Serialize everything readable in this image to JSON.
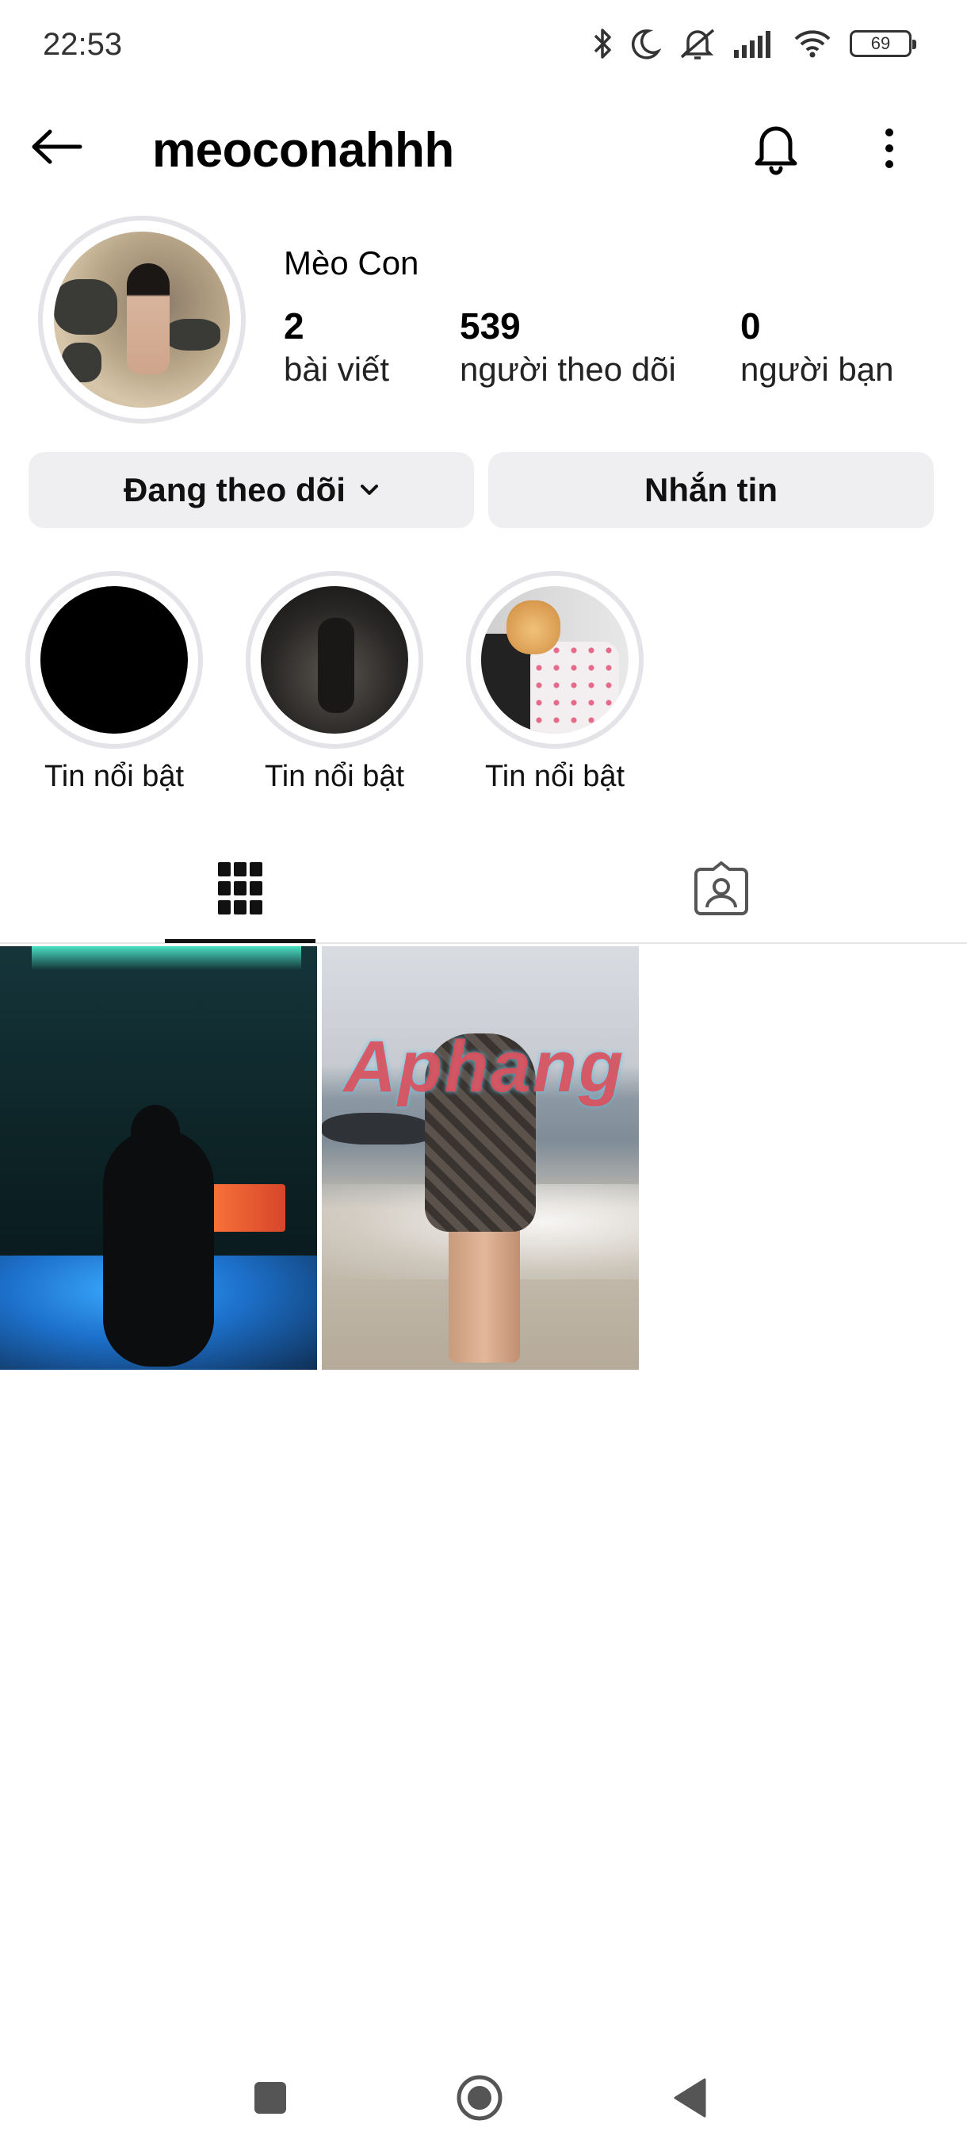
{
  "status_bar": {
    "time": "22:53",
    "battery": "69",
    "icons": [
      "bluetooth-icon",
      "moon-icon",
      "mute-icon",
      "signal-icon",
      "wifi-icon",
      "battery-icon"
    ]
  },
  "header": {
    "username": "meoconahhh",
    "back_icon": "arrow-left-icon",
    "bell_icon": "bell-icon",
    "more_icon": "more-vertical-icon"
  },
  "profile": {
    "display_name": "Mèo Con",
    "stats": [
      {
        "value": "2",
        "label": "bài viết"
      },
      {
        "value": "539",
        "label": "người theo dõi"
      },
      {
        "value": "0",
        "label": "người bạn"
      }
    ]
  },
  "actions": {
    "following_label": "Đang theo dõi",
    "message_label": "Nhắn tin"
  },
  "highlights": [
    {
      "label": "Tin nổi bật"
    },
    {
      "label": "Tin nổi bật"
    },
    {
      "label": "Tin nổi bật"
    }
  ],
  "tabs": [
    {
      "icon": "grid-icon",
      "active": true
    },
    {
      "icon": "tagged-icon",
      "active": false
    }
  ],
  "posts": {
    "watermark": "Aphang"
  },
  "colors": {
    "button_bg": "#efeff2",
    "ring": "#e3e3e8",
    "text": "#000000"
  }
}
